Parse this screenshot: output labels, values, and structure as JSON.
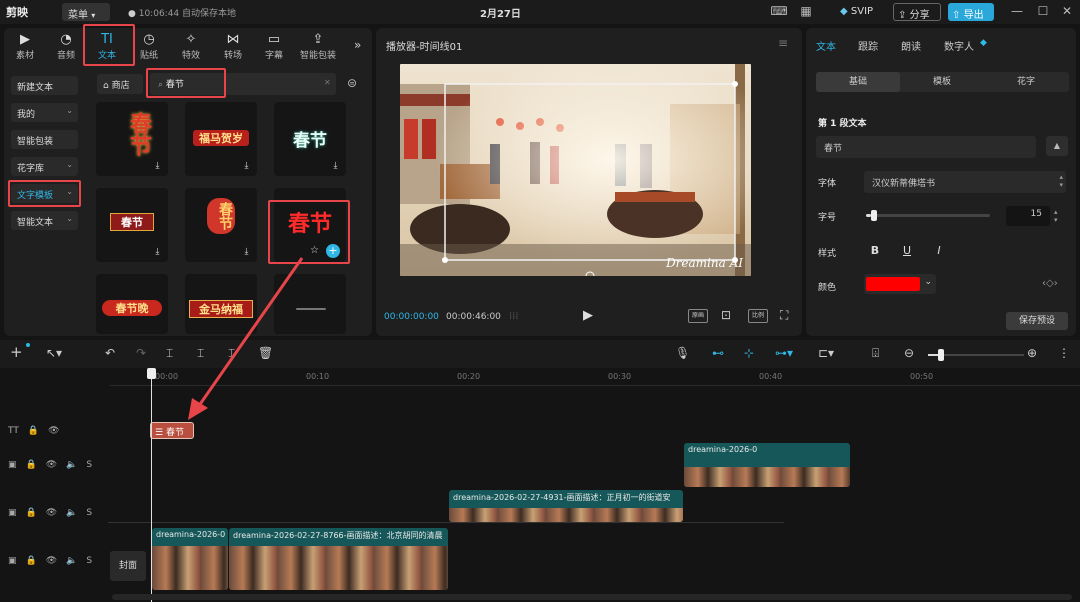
{
  "titlebar": {
    "app": "剪映",
    "menu": "菜单",
    "autosave": "10:06:44 自动保存本地",
    "date": "2月27日",
    "svip": "SVIP",
    "share": "分享",
    "export": "导出"
  },
  "tabs": [
    {
      "label": "素材",
      "icon": "media-icon"
    },
    {
      "label": "音频",
      "icon": "audio-icon"
    },
    {
      "label": "文本",
      "icon": "text-icon"
    },
    {
      "label": "贴纸",
      "icon": "sticker-icon"
    },
    {
      "label": "特效",
      "icon": "effects-icon"
    },
    {
      "label": "转场",
      "icon": "transition-icon"
    },
    {
      "label": "字幕",
      "icon": "subtitle-icon"
    },
    {
      "label": "智能包装",
      "icon": "smart-pack-icon"
    }
  ],
  "sidebar": [
    {
      "label": "新建文本"
    },
    {
      "label": "我的"
    },
    {
      "label": "智能包装"
    },
    {
      "label": "花字库"
    },
    {
      "label": "文字模板"
    },
    {
      "label": "智能文本"
    }
  ],
  "store": "商店",
  "search": {
    "value": "春节"
  },
  "templates": [
    "春节",
    "福马贺岁",
    "春节",
    "春节",
    "春节",
    "春节",
    "春节晚",
    "金马纳福",
    ""
  ],
  "player": {
    "title": "播放器-时间线01",
    "current": "00:00:00:00",
    "total": "00:00:46:00",
    "watermark": "Dreamina AI",
    "btn_original": "原画",
    "btn_ratio": "比例"
  },
  "props": {
    "tabs": [
      "文本",
      "跟踪",
      "朗读",
      "数字人"
    ],
    "segments": [
      "基础",
      "模板",
      "花字"
    ],
    "section": "第 1 段文本",
    "text_value": "春节",
    "font_label": "字体",
    "font_value": "汉仪新蒂佛塔书",
    "size_label": "字号",
    "size_value": "15",
    "size_fraction": 0.04,
    "style_label": "样式",
    "bold": "B",
    "underline": "U",
    "italic": "I",
    "color_label": "颜色",
    "color_value": "#ff0000",
    "save_preset": "保存预设"
  },
  "ruler": [
    "00:00",
    "00:10",
    "00:20",
    "00:30",
    "00:40",
    "00:50"
  ],
  "timeline": {
    "text_clip": "春节",
    "clip_top": "dreamina-2026-0",
    "clip_mid": "dreamina-2026-02-27-4931-画面描述：正月初一的街道安",
    "clip_main_a": "dreamina-2026-0",
    "clip_main_b": "dreamina-2026-02-27-8766-画面描述：北京胡同的清晨",
    "cover": "封面"
  },
  "colors": {
    "accent": "#2fb7e6",
    "annotation": "#e8454a",
    "clip": "#16585a"
  }
}
